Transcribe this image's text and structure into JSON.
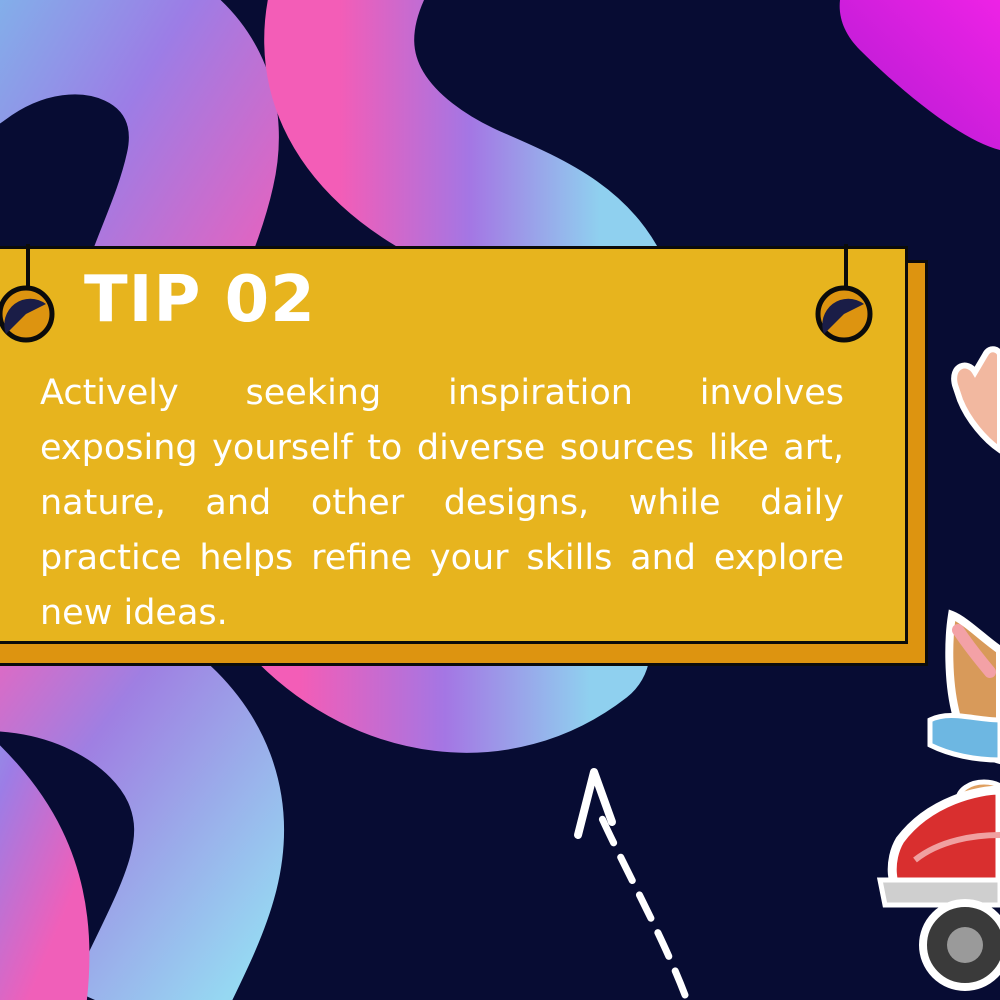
{
  "tip": {
    "title": "TIP 02",
    "body": "Actively seeking inspiration involves exposing yourself to diverse sources like art, nature, and other designs, while daily practice helps refine your skills and explore new ideas."
  },
  "colors": {
    "background": "#070c33",
    "card": "#e7b41e",
    "card_shadow": "#dd9410",
    "text": "#ffffff"
  },
  "decorations": [
    "swirl-tube-graphic",
    "magenta-blob",
    "dashed-arrow-icon",
    "dog-on-scooter-sticker"
  ]
}
